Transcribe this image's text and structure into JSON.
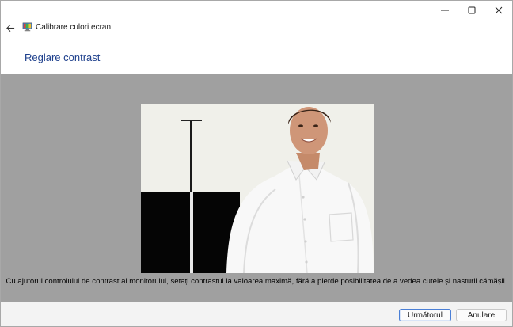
{
  "window": {
    "title": "Calibrare culori ecran"
  },
  "page": {
    "heading": "Reglare contrast"
  },
  "content": {
    "instruction": "Cu ajutorul controlului de contrast al monitorului, setați contrastul la valoarea maximă, fără a pierde posibilitatea de a vedea cutele și nasturii cămășii."
  },
  "footer": {
    "next_label": "Următorul",
    "cancel_label": "Anulare"
  },
  "icons": {
    "back": "arrow-left-icon",
    "app": "display-color-calibration-icon",
    "minimize": "minimize-icon",
    "maximize": "maximize-icon",
    "close": "close-icon"
  },
  "colors": {
    "heading": "#1d3f8c",
    "main_background": "#a0a0a0",
    "primary_button_border": "#4a7fd6"
  }
}
